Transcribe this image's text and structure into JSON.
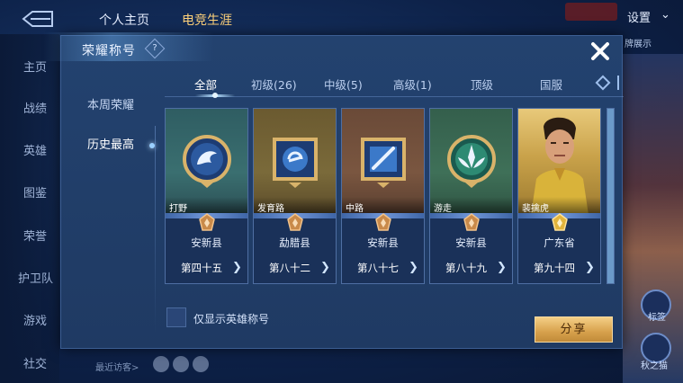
{
  "background": {
    "tabs": [
      "个人主页",
      "电竞生涯"
    ],
    "settings_label": "设置",
    "display_label": "牌展示",
    "side_items": [
      "主页",
      "战绩",
      "英雄",
      "图鉴",
      "荣誉",
      "护卫队",
      "游戏",
      "社交"
    ],
    "bottom_recent_label": "最近访客>",
    "right_badges": [
      "标签",
      "秋之猫"
    ]
  },
  "modal": {
    "title": "荣耀称号",
    "help_glyph": "?",
    "side_nav": [
      "本周荣耀",
      "历史最高"
    ],
    "tabs": [
      "全部",
      "初级(26)",
      "中级(5)",
      "高级(1)",
      "顶级",
      "国服"
    ],
    "cards": [
      {
        "role": "打野",
        "region": "安新县",
        "rank": "第四十五",
        "emblem": "dragon-emblem-icon",
        "art_color": "#3a6f70"
      },
      {
        "role": "发育路",
        "region": "勐腊县",
        "rank": "第八十二",
        "emblem": "marksman-emblem-icon",
        "art_color": "#7a6a3a"
      },
      {
        "role": "中路",
        "region": "安新县",
        "rank": "第八十七",
        "emblem": "mage-emblem-icon",
        "art_color": "#7a5640"
      },
      {
        "role": "游走",
        "region": "安新县",
        "rank": "第八十九",
        "emblem": "support-emblem-icon",
        "art_color": "#3f7058"
      },
      {
        "role": "裴擒虎",
        "region": "广东省",
        "rank": "第九十四",
        "emblem": "hero-portrait-icon",
        "art_color": "#b89a3a"
      }
    ],
    "filter_label": "仅显示英雄称号",
    "share_label": "分享"
  }
}
